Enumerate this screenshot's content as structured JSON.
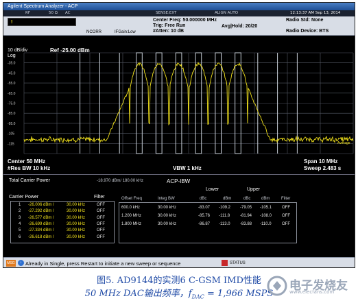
{
  "window": {
    "title": "Agilent Spectrum Analyzer - ACP"
  },
  "header": {
    "chips": [
      "RF",
      "50 Ω",
      "AC",
      "SENSE:EXT",
      "ALIGN AUTO"
    ],
    "timestamp": "12:13:37 AM Sep 13, 2014",
    "center_freq": "Center Freq: 50.000000 MHz",
    "trig": "Trig: Free Run",
    "avg_hold": "Avg|Hold: 20/20",
    "atten": "#Atten: 10 dB",
    "ncorr": "NCORR",
    "if_gain": "IFGain:Low",
    "radio_std": "Radio Std: None",
    "radio_device": "Radio Device: BTS",
    "left_box_label": "!"
  },
  "plot": {
    "scale": "10 dB/div",
    "log": "Log",
    "ref": "Ref -25.00 dBm",
    "y_ticks": [
      "-35.0",
      "-45.0",
      "-55.0",
      "-65.0",
      "-75.0",
      "-85.0",
      "-95.0",
      "-105",
      "-115"
    ],
    "trace_label": "Average",
    "colors": {
      "trace": "#f3e31c",
      "grid": "#555a66",
      "markers": "#c9cfd8",
      "background": "#000000"
    }
  },
  "bottom_info": {
    "center": "Center 50 MHz",
    "res_bw": "#Res BW 10 kHz",
    "vbw": "VBW 1 kHz",
    "span": "Span 10 MHz",
    "sweep": "Sweep 2.483 s"
  },
  "table": {
    "total_carrier_label": "Total Carrier Power",
    "total_carrier_value": "-18.970 dBm/ 180.00 kHz",
    "acp_title": "ACP-IBW",
    "carrier_power_header": "Carrier Power",
    "filter_header": "Filter",
    "carriers": [
      {
        "n": "1",
        "power": "-26.006 dBm /",
        "bw": "30.00 kHz",
        "filter": "OFF"
      },
      {
        "n": "2",
        "power": "-27.292 dBm /",
        "bw": "30.00 kHz",
        "filter": "OFF"
      },
      {
        "n": "3",
        "power": "-26.577 dBm /",
        "bw": "30.00 kHz",
        "filter": "OFF"
      },
      {
        "n": "4",
        "power": "-26.699 dBm /",
        "bw": "30.00 kHz",
        "filter": "OFF"
      },
      {
        "n": "5",
        "power": "-27.334 dBm /",
        "bw": "30.00 kHz",
        "filter": "OFF"
      },
      {
        "n": "6",
        "power": "-26.618 dBm /",
        "bw": "30.00 kHz",
        "filter": "OFF"
      }
    ],
    "offset_headers": {
      "lower": "Lower",
      "upper": "Upper",
      "offset_freq": "Offset Freq",
      "integ_bw": "Integ BW",
      "dbc1": "dBc",
      "dbm1": "dBm",
      "dbc2": "dBc",
      "dbm2": "dBm",
      "filter": "Filter"
    },
    "offsets": [
      {
        "freq": "600.0 kHz",
        "bw": "30.00 kHz",
        "ldbc": "-83.07",
        "ldbm": "-109.2",
        "udbc": "-79.05",
        "udbm": "-105.1",
        "filter": "OFF"
      },
      {
        "freq": "1.200 MHz",
        "bw": "30.00 kHz",
        "ldbc": "-85.76",
        "ldbm": "-111.8",
        "udbc": "-81.94",
        "udbm": "-108.0",
        "filter": "OFF"
      },
      {
        "freq": "1.800 MHz",
        "bw": "30.00 kHz",
        "ldbc": "-86.87",
        "ldbm": "-113.0",
        "udbc": "-83.88",
        "udbm": "-110.0",
        "filter": "OFF"
      }
    ]
  },
  "message_bar": {
    "badge": "MSG",
    "text": "Already in Single, press Restart to initiate a new sweep or sequence",
    "status": "STATUS"
  },
  "caption": {
    "line1": "图5. AD9144的实测6 C-GSM IMD性能",
    "line2": "50 MHz DAC输出频率，f",
    "line2_sub": "DAC",
    "line2_tail": " = 1,966 MSPS"
  },
  "watermark": {
    "text": "电子发烧友",
    "url": "www.elecfans.com"
  }
}
